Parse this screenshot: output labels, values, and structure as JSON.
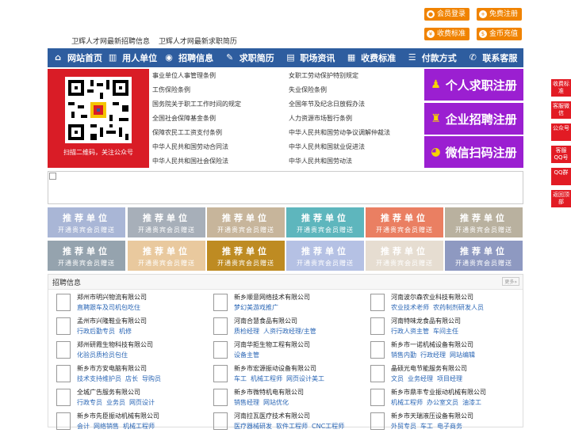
{
  "top_buttons": {
    "member_login": "会员登录",
    "free_register": "免费注册",
    "fee_standard": "收费标准",
    "coin_recharge": "金币充值"
  },
  "tagline": {
    "jobs": "卫辉人才网最新招聘信息",
    "resumes": "卫辉人才网最新求职简历"
  },
  "nav": [
    {
      "label": "网站首页",
      "icon": "home-icon"
    },
    {
      "label": "用人单位",
      "icon": "building-icon"
    },
    {
      "label": "招聘信息",
      "icon": "megaphone-icon"
    },
    {
      "label": "求职简历",
      "icon": "resume-icon"
    },
    {
      "label": "职场资讯",
      "icon": "news-icon"
    },
    {
      "label": "收费标准",
      "icon": "fee-icon"
    },
    {
      "label": "付款方式",
      "icon": "payment-icon"
    },
    {
      "label": "联系客服",
      "icon": "phone-icon"
    }
  ],
  "qr": {
    "caption": "扫描二维码，关注公众号"
  },
  "policy_links": {
    "left": [
      "事业单位人事管理条例",
      "工伤保险条例",
      "国务院关于职工工作时间的规定",
      "全国社会保障基金条例",
      "保障农民工工资支付条例",
      "中华人民共和国劳动合同法",
      "中华人民共和国社会保险法"
    ],
    "right": [
      "女职工劳动保护特别规定",
      "失业保险条例",
      "全国年节及纪念日放假办法",
      "人力资源市场暂行条例",
      "中华人民共和国劳动争议调解仲裁法",
      "中华人民共和国就业促进法",
      "中华人民共和国劳动法"
    ]
  },
  "register_buttons": {
    "personal": "个人求职注册",
    "company": "企业招聘注册",
    "wechat": "微信扫码注册"
  },
  "recommended": {
    "title": "推荐单位",
    "subtitle": "开通贵宾会员赠送",
    "colors": [
      "#a9b6d6",
      "#a7afb9",
      "#c7b59b",
      "#5eb6bd",
      "#ea7f62",
      "#b9b19f",
      "#95a3ae",
      "#e9c99e",
      "#be8b22",
      "#b5c1e4",
      "#e6ddd1",
      "#8e99c1"
    ]
  },
  "jobs_section": {
    "title": "招聘信息",
    "more": "更多»",
    "companies": [
      {
        "name": "郑州市明兴物流有限公司",
        "jobs": [
          "直聘跟车及司机包吃住"
        ]
      },
      {
        "name": "新乡顺意网络技术有限公司",
        "jobs": [
          "梦幻美游戏推广"
        ]
      },
      {
        "name": "河南波尔森农业科技有限公司",
        "jobs": [
          "农业技术老师",
          "农药制剂研发人员"
        ]
      },
      {
        "name": "孟州市兴隆鞋业有限公司",
        "jobs": [
          "行政后勤专员",
          "机修"
        ]
      },
      {
        "name": "河南合慧食品有限公司",
        "jobs": [
          "质检经理",
          "人资行政经理/主管"
        ]
      },
      {
        "name": "河南特味龙食品有限公司",
        "jobs": [
          "行政人资主管",
          "车间主任"
        ]
      },
      {
        "name": "郑州研霞生物科技有限公司",
        "jobs": [
          "化验员质检员包住"
        ]
      },
      {
        "name": "河南华拒生物工程有限公司",
        "jobs": [
          "设备主管"
        ]
      },
      {
        "name": "新乡市一诺机械设备有限公司",
        "jobs": [
          "销售内勤",
          "行政经理",
          "网站编辑"
        ]
      },
      {
        "name": "新乡市方安电脑有限公司",
        "jobs": [
          "技术支持维护员",
          "店长",
          "导购员"
        ]
      },
      {
        "name": "新乡市宏源振动设备有限公司",
        "jobs": [
          "车工",
          "机械工程师",
          "网页设计美工"
        ]
      },
      {
        "name": "晶硕光电节能服务有限公司",
        "jobs": [
          "文员",
          "业务经理",
          "项目经理"
        ]
      },
      {
        "name": "全城广告服务有限公司",
        "jobs": [
          "行政专员",
          "业务员",
          "网页设计"
        ]
      },
      {
        "name": "新乡市微特机电有限公司",
        "jobs": [
          "销售经理",
          "网站优化"
        ]
      },
      {
        "name": "新乡市鼎丰专业振动机械有限公司",
        "jobs": [
          "机械工程师",
          "办公室文员",
          "油漆工"
        ]
      },
      {
        "name": "新乡市先臣振动机械有限公司",
        "jobs": [
          "会计",
          "网络销售",
          "机械工程师"
        ]
      },
      {
        "name": "河南拉瓦医疗技术有限公司",
        "jobs": [
          "医疗器械研发",
          "软件工程师",
          "CNC工程师"
        ]
      },
      {
        "name": "新乡市天瑞液压设备有限公司",
        "jobs": [
          "外贸专员",
          "车工",
          "电子商务"
        ]
      }
    ]
  },
  "side_buttons": [
    "收费标准",
    "客服微信",
    "公众号",
    "客服QQ号",
    "QQ群",
    "返回顶部"
  ]
}
